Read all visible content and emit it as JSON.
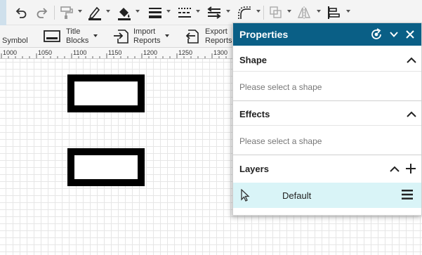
{
  "ribbon": {
    "symbol_label": "Symbol",
    "title_blocks_line1": "Title",
    "title_blocks_line2": "Blocks",
    "import_reports_line1": "Import",
    "import_reports_line2": "Reports",
    "export_reports_line1": "Export",
    "export_reports_line2": "Reports"
  },
  "ruler": {
    "ticks": [
      "1000",
      "1050",
      "1100",
      "1150",
      "1200",
      "1250",
      "1300"
    ]
  },
  "properties": {
    "title": "Properties",
    "shape": {
      "title": "Shape",
      "body": "Please select a shape"
    },
    "effects": {
      "title": "Effects",
      "body": "Please select a shape"
    },
    "layers": {
      "title": "Layers",
      "items": [
        {
          "name": "Default"
        }
      ]
    }
  },
  "colors": {
    "panel_header": "#0a5f86",
    "selected_layer": "#d9f4f7"
  },
  "icons": {
    "undo": "undo-icon",
    "redo": "redo-icon",
    "fill": "paint-bucket-icon",
    "close": "close-icon"
  }
}
